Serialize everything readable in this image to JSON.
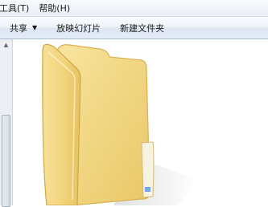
{
  "menu": {
    "items": [
      {
        "label": "工具(T)"
      },
      {
        "label": "帮助(H)"
      }
    ]
  },
  "toolbar": {
    "share_label": "共享",
    "slideshow_label": "放映幻灯片",
    "new_folder_label": "新建文件夹"
  },
  "icons": {
    "share_dropdown": "chevron-down-icon",
    "scroll_up": "scroll-up-arrow",
    "main_item": "folder-icon"
  },
  "colors": {
    "folder": "#f2d77f",
    "toolbar": "#e4ecf7"
  }
}
